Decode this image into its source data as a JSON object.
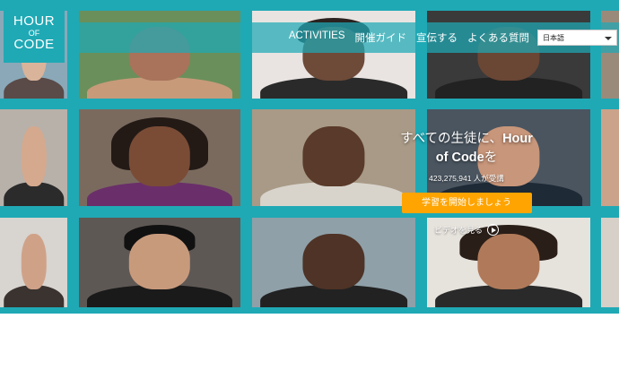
{
  "logo": {
    "line1": "HOUR",
    "line2": "OF",
    "line3": "CODE"
  },
  "nav": {
    "items": [
      "ACTIVITIES",
      "開催ガイド",
      "宣伝する",
      "よくある質問"
    ]
  },
  "language": {
    "selected": "日本語"
  },
  "hero": {
    "headline_part1": "すべての生徒に、",
    "headline_bold1": "Hour",
    "headline_bold2": "of Code",
    "headline_part2": "を",
    "learner_count": "423,275,941 人が受講",
    "start_button": "学習を開始しましょう",
    "watch_video": "ビデオを見る"
  },
  "colors": {
    "teal": "#1fa9b5",
    "orange": "#ffa400"
  }
}
